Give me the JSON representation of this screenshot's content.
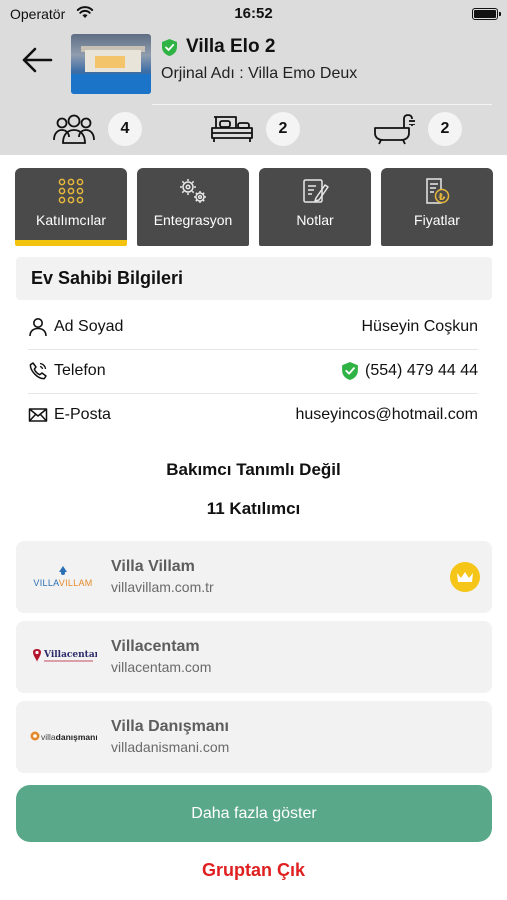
{
  "status_bar": {
    "carrier": "Operatör",
    "time": "16:52"
  },
  "header": {
    "title": "Villa Elo 2",
    "original_name": "Orjinal Adı : Villa Emo Deux",
    "stats": [
      {
        "icon": "people-icon",
        "value": "4"
      },
      {
        "icon": "bed-icon",
        "value": "2"
      },
      {
        "icon": "bathtub-icon",
        "value": "2"
      }
    ]
  },
  "tabs": [
    {
      "label": "Katılımcılar",
      "icon": "grid-icon",
      "active": true
    },
    {
      "label": "Entegrasyon",
      "icon": "gears-icon",
      "active": false
    },
    {
      "label": "Notlar",
      "icon": "notes-icon",
      "active": false
    },
    {
      "label": "Fiyatlar",
      "icon": "price-list-icon",
      "active": false
    }
  ],
  "owner": {
    "section_title": "Ev Sahibi Bilgileri",
    "rows": [
      {
        "label": "Ad Soyad",
        "value": "Hüseyin Coşkun",
        "icon": "person-icon"
      },
      {
        "label": "Telefon",
        "value": "(554) 479 44 44",
        "icon": "phone-icon",
        "verified": true
      },
      {
        "label": "E-Posta",
        "value": "huseyincos@hotmail.com",
        "icon": "mail-icon"
      }
    ]
  },
  "caretaker_status": "Bakımcı Tanımlı Değil",
  "participants_count": "11 Katılımcı",
  "participants": [
    {
      "name": "Villa Villam",
      "domain": "villavillam.com.tr",
      "logo_text": "VILLAVILLAM",
      "owner_badge": true
    },
    {
      "name": "Villacentam",
      "domain": "villacentam.com",
      "logo_text": "Villacentam",
      "owner_badge": false
    },
    {
      "name": "Villa Danışmanı",
      "domain": "villadanismani.com",
      "logo_text": "villadanışmanı",
      "owner_badge": false
    }
  ],
  "buttons": {
    "show_more": "Daha fazla göster",
    "leave_group": "Gruptan Çık"
  },
  "colors": {
    "accent_green": "#5aa88a",
    "tab_active_underline": "#f2c40f",
    "danger": "#e02020",
    "verified": "#2fb344",
    "crown": "#f5c518"
  }
}
